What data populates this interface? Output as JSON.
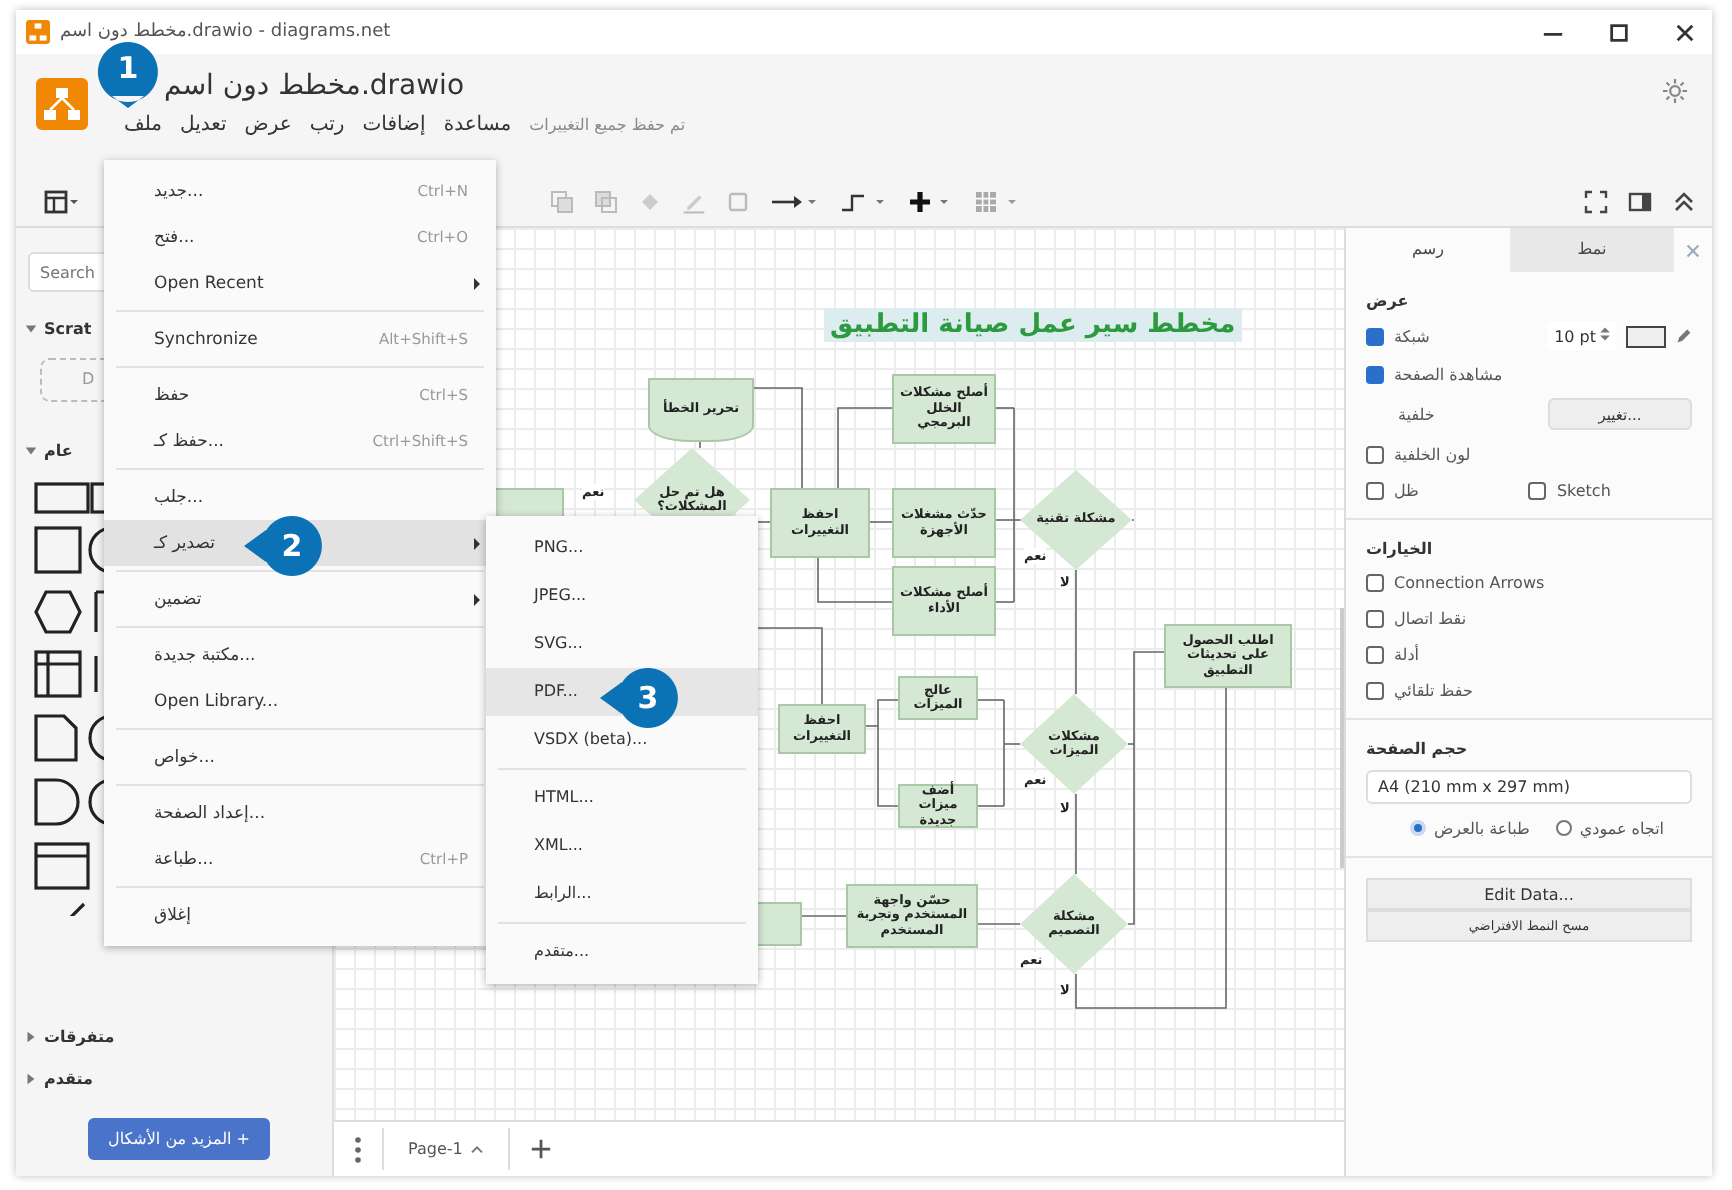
{
  "window": {
    "title": "مخطط دون اسم.drawio - diagrams.net"
  },
  "header": {
    "document_title": "مخطط دون اسم.drawio",
    "menu": [
      "مساعدة",
      "إضافات",
      "رتب",
      "عرض",
      "تعديل",
      "ملف"
    ],
    "save_status": "تم حفظ جميع التغييرات"
  },
  "sidebar": {
    "search": {
      "placeholder": "Search"
    },
    "scratchpad": {
      "label": "Scrat",
      "drop_hint": "D"
    },
    "sections": [
      {
        "label": "عام",
        "expanded": true
      },
      {
        "label": "متفرقات",
        "expanded": false
      },
      {
        "label": "متقدم",
        "expanded": false
      }
    ],
    "more_shapes_button": "المزيد من الأشكال +"
  },
  "file_menu": {
    "groups": [
      [
        {
          "label": "جديد...",
          "shortcut": "Ctrl+N",
          "submenu": false,
          "selected": false
        },
        {
          "label": "فتح...",
          "shortcut": "Ctrl+O",
          "submenu": false,
          "selected": false
        },
        {
          "label": "Open Recent",
          "submenu": true,
          "selected": false
        }
      ],
      [
        {
          "label": "Synchronize",
          "shortcut": "Alt+Shift+S",
          "submenu": false,
          "selected": false
        }
      ],
      [
        {
          "label": "حفظ",
          "shortcut": "Ctrl+S",
          "submenu": false,
          "selected": false
        },
        {
          "label": "حفظ كـ...",
          "shortcut": "Ctrl+Shift+S",
          "submenu": false,
          "selected": false
        }
      ],
      [
        {
          "label": "جلب...",
          "submenu": false,
          "selected": false
        },
        {
          "label": "تصدير كـ",
          "submenu": true,
          "selected": true
        }
      ],
      [
        {
          "label": "تضمين",
          "submenu": true,
          "selected": false
        }
      ],
      [
        {
          "label": "مكتبة جديدة...",
          "submenu": false,
          "selected": false
        },
        {
          "label": "Open Library...",
          "submenu": false,
          "selected": false
        }
      ],
      [
        {
          "label": "خواص...",
          "submenu": false,
          "selected": false
        }
      ],
      [
        {
          "label": "إعداد الصفحة...",
          "submenu": false,
          "selected": false
        },
        {
          "label": "طباعة...",
          "shortcut": "Ctrl+P",
          "submenu": false,
          "selected": false
        }
      ],
      [
        {
          "label": "إغلاق",
          "submenu": false,
          "selected": false
        }
      ]
    ]
  },
  "export_menu": {
    "groups": [
      [
        {
          "label": "PNG...",
          "selected": false
        },
        {
          "label": "JPEG...",
          "selected": false
        },
        {
          "label": "SVG...",
          "selected": false
        },
        {
          "label": "PDF...",
          "selected": true
        },
        {
          "label": "VSDX (beta)...",
          "selected": false
        }
      ],
      [
        {
          "label": "HTML...",
          "selected": false
        },
        {
          "label": "XML...",
          "selected": false
        },
        {
          "label": "الرابط...",
          "selected": false
        }
      ],
      [
        {
          "label": "متقدم...",
          "selected": false
        }
      ]
    ]
  },
  "callouts": [
    "1",
    "2",
    "3"
  ],
  "diagram": {
    "title": "مخطط سير عمل صيانة التطبيق",
    "nodes": [
      {
        "kind": "tag",
        "text": "تحرير الخطأ"
      },
      {
        "kind": "decision",
        "text": "هل تم حل المشكلات؟"
      },
      {
        "kind": "process",
        "text": "احفظ التغييرات"
      },
      {
        "kind": "process",
        "text": "أصلح مشكلات الخلل البرمجي"
      },
      {
        "kind": "process",
        "text": "حدّث مشغلات الأجهزة"
      },
      {
        "kind": "process",
        "text": "أصلح مشكلات الأداء"
      },
      {
        "kind": "decision",
        "text": "مشكلة تقنية"
      },
      {
        "kind": "process",
        "text": "اطلب الحصول على تحديثات التطبيق"
      },
      {
        "kind": "process",
        "text": "عالج الميزات"
      },
      {
        "kind": "process",
        "text": "احفظ التغييرات"
      },
      {
        "kind": "process",
        "text": "أضف ميزات جديدة"
      },
      {
        "kind": "decision",
        "text": "مشكلات الميزات"
      },
      {
        "kind": "decision",
        "text": "مشكلة التصميم"
      },
      {
        "kind": "process",
        "text": "حسّن واجهة المستخدم وتجربة المستخدم"
      }
    ],
    "edge_labels": [
      "نعم",
      "نعم",
      "لا",
      "نعم",
      "لا",
      "نعم",
      "لا"
    ]
  },
  "format_panel": {
    "tabs": [
      {
        "label": "نمط",
        "selected": false
      },
      {
        "label": "رسم",
        "selected": true
      }
    ],
    "view_heading": "عرض",
    "grid": {
      "label": "شبكة",
      "checked": true,
      "size": "10 pt"
    },
    "page_view": {
      "label": "مشاهدة الصفحة",
      "checked": true
    },
    "background": {
      "label": "خلفية",
      "button": "تغيير..."
    },
    "background_color": {
      "label": "لون الخلفية",
      "checked": false
    },
    "shadow": {
      "label": "ظل",
      "checked": false
    },
    "sketch": {
      "label": "Sketch",
      "checked": false
    },
    "options_heading": "الخيارات",
    "options": [
      {
        "label": "Connection Arrows",
        "checked": false
      },
      {
        "label": "نقط اتصال",
        "checked": false
      },
      {
        "label": "أدلة",
        "checked": false
      },
      {
        "label": "حفظ تلقائي",
        "checked": false
      }
    ],
    "page_size_heading": "حجم الصفحة",
    "page_size": "A4 (210 mm x 297 mm)",
    "orientation": [
      {
        "label": "اتجاه عمودي",
        "selected": false
      },
      {
        "label": "طباعة بالعرض",
        "selected": true
      }
    ],
    "edit_data_button": "Edit Data...",
    "default_style_button": "مسح النمط الافتراضي"
  },
  "page_tabs": [
    {
      "label": "Page-1",
      "selected": true
    }
  ]
}
